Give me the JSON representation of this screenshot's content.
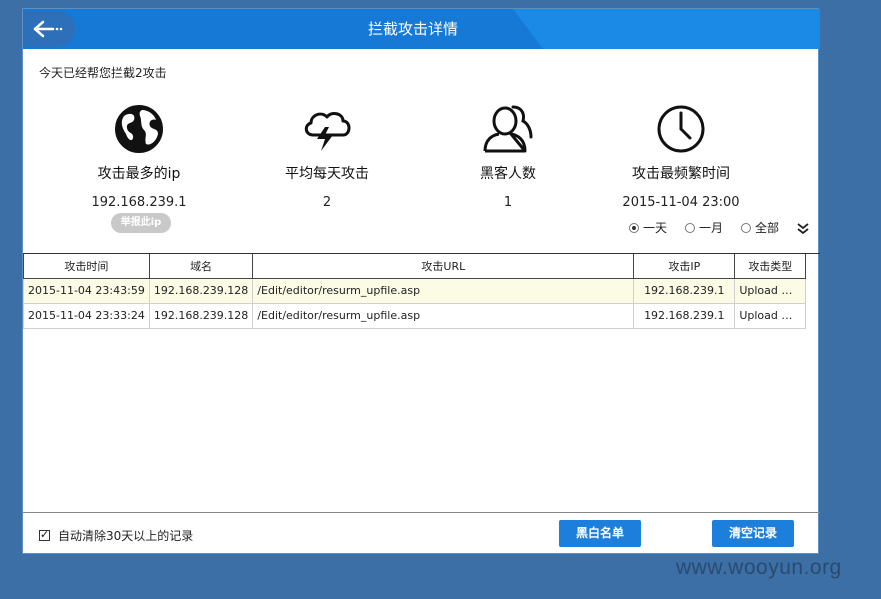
{
  "window": {
    "title": "拦截攻击详情"
  },
  "summary": "今天已经帮您拦截2攻击",
  "stats": [
    {
      "label": "攻击最多的ip",
      "value": "192.168.239.1",
      "icon": "globe-icon"
    },
    {
      "label": "平均每天攻击",
      "value": "2",
      "icon": "lightning-cloud-icon"
    },
    {
      "label": "黑客人数",
      "value": "1",
      "icon": "hacker-users-icon"
    },
    {
      "label": "攻击最频繁时间",
      "value": "2015-11-04 23:00",
      "icon": "clock-icon"
    }
  ],
  "report_button": "举报此ip",
  "range": {
    "options": [
      "一天",
      "一月",
      "全部"
    ],
    "selected": "一天"
  },
  "table": {
    "columns": [
      "攻击时间",
      "域名",
      "攻击URL",
      "攻击IP",
      "攻击类型"
    ],
    "rows": [
      [
        "2015-11-04 23:43:59",
        "192.168.239.128",
        "/Edit/editor/resurm_upfile.asp",
        "192.168.239.1",
        "Upload Web..."
      ],
      [
        "2015-11-04 23:33:24",
        "192.168.239.128",
        "/Edit/editor/resurm_upfile.asp",
        "192.168.239.1",
        "Upload Web..."
      ]
    ]
  },
  "footer": {
    "auto_clear_label": "自动清除30天以上的记录",
    "auto_clear_checked": true,
    "blacklist_button": "黑白名单",
    "clear_button": "清空记录"
  },
  "watermark": "www.wooyun.org",
  "colors": {
    "title_bar": "#1a8ae6",
    "button": "#1b7fdb",
    "background": "#3b6fa6"
  }
}
